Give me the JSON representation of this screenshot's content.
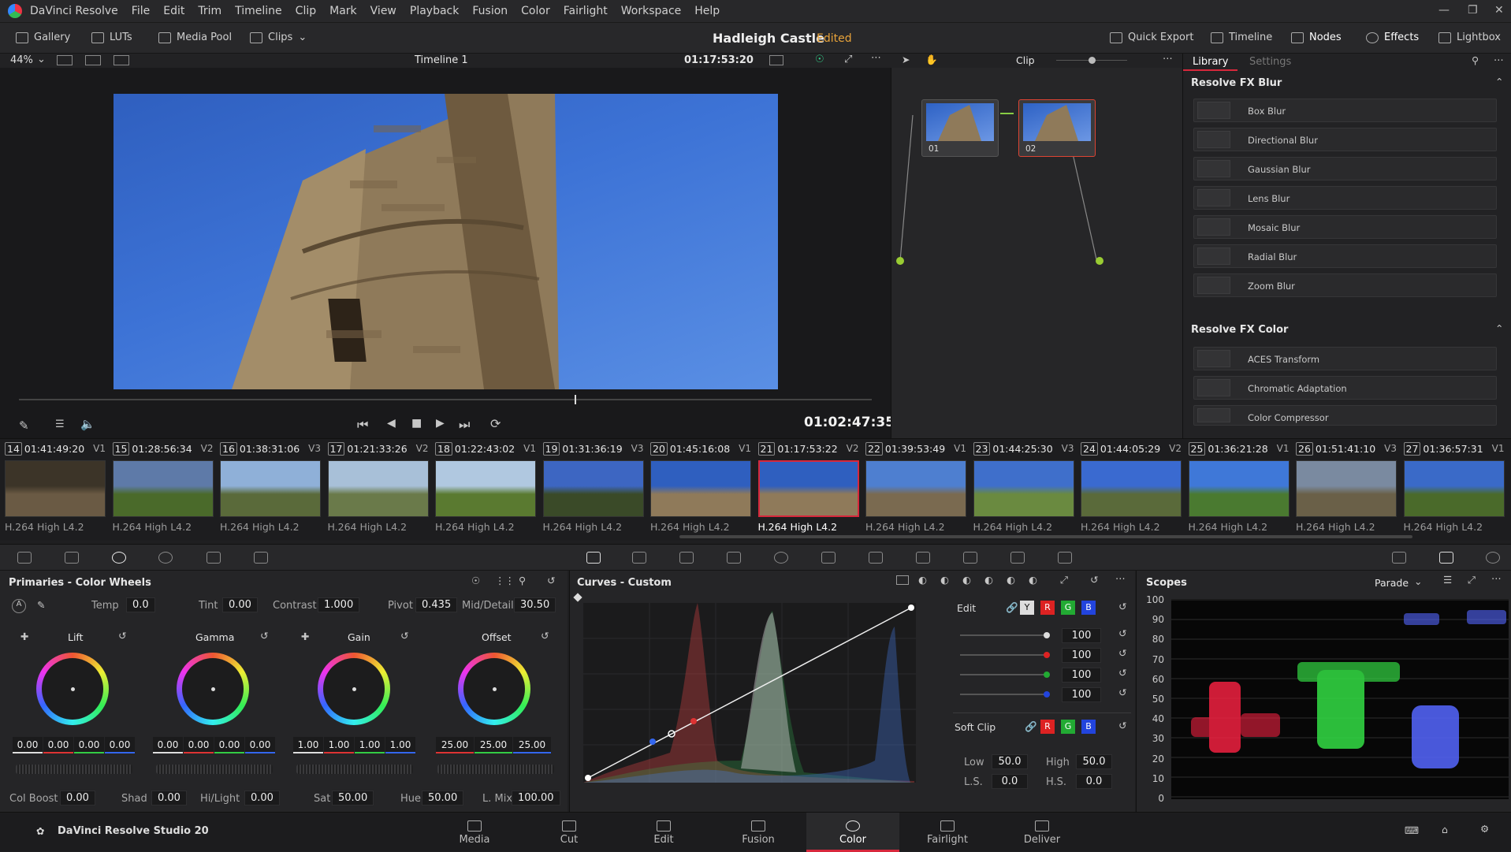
{
  "app": {
    "name": "DaVinci Resolve",
    "menus": [
      "File",
      "Edit",
      "Trim",
      "Timeline",
      "Clip",
      "Mark",
      "View",
      "Playback",
      "Fusion",
      "Color",
      "Fairlight",
      "Workspace",
      "Help"
    ]
  },
  "toolbar": {
    "gallery": "Gallery",
    "luts": "LUTs",
    "media_pool": "Media Pool",
    "clips": "Clips",
    "project_title": "Hadleigh Castle",
    "edited": "Edited",
    "quick_export": "Quick Export",
    "timeline": "Timeline",
    "nodes": "Nodes",
    "effects": "Effects",
    "lightbox": "Lightbox"
  },
  "viewer": {
    "zoom": "44%",
    "timeline_name": "Timeline 1",
    "source_tc": "01:17:53:20",
    "timecode": "01:02:47:35"
  },
  "node_editor": {
    "mode": "Clip",
    "nodes": [
      {
        "label": "01"
      },
      {
        "label": "02"
      }
    ]
  },
  "library": {
    "tabs": [
      "Library",
      "Settings"
    ],
    "sections": [
      {
        "title": "Resolve FX Blur",
        "items": [
          "Box Blur",
          "Directional Blur",
          "Gaussian Blur",
          "Lens Blur",
          "Mosaic Blur",
          "Radial Blur",
          "Zoom Blur"
        ]
      },
      {
        "title": "Resolve FX Color",
        "items": [
          "ACES Transform",
          "Chromatic Adaptation",
          "Color Compressor"
        ]
      }
    ]
  },
  "clips": [
    {
      "num": "14",
      "tc": "01:41:49:20",
      "track": "V1",
      "codec": "H.264 High L4.2"
    },
    {
      "num": "15",
      "tc": "01:28:56:34",
      "track": "V2",
      "codec": "H.264 High L4.2"
    },
    {
      "num": "16",
      "tc": "01:38:31:06",
      "track": "V3",
      "codec": "H.264 High L4.2"
    },
    {
      "num": "17",
      "tc": "01:21:33:26",
      "track": "V2",
      "codec": "H.264 High L4.2"
    },
    {
      "num": "18",
      "tc": "01:22:43:02",
      "track": "V1",
      "codec": "H.264 High L4.2"
    },
    {
      "num": "19",
      "tc": "01:31:36:19",
      "track": "V3",
      "codec": "H.264 High L4.2"
    },
    {
      "num": "20",
      "tc": "01:45:16:08",
      "track": "V1",
      "codec": "H.264 High L4.2"
    },
    {
      "num": "21",
      "tc": "01:17:53:22",
      "track": "V2",
      "codec": "H.264 High L4.2"
    },
    {
      "num": "22",
      "tc": "01:39:53:49",
      "track": "V1",
      "codec": "H.264 High L4.2"
    },
    {
      "num": "23",
      "tc": "01:44:25:30",
      "track": "V3",
      "codec": "H.264 High L4.2"
    },
    {
      "num": "24",
      "tc": "01:44:05:29",
      "track": "V2",
      "codec": "H.264 High L4.2"
    },
    {
      "num": "25",
      "tc": "01:36:21:28",
      "track": "V1",
      "codec": "H.264 High L4.2"
    },
    {
      "num": "26",
      "tc": "01:51:41:10",
      "track": "V3",
      "codec": "H.264 High L4.2"
    },
    {
      "num": "27",
      "tc": "01:36:57:31",
      "track": "V1",
      "codec": "H.264 High L4.2"
    }
  ],
  "primaries": {
    "title": "Primaries - Color Wheels",
    "temp_label": "Temp",
    "temp": "0.0",
    "tint_label": "Tint",
    "tint": "0.00",
    "contrast_label": "Contrast",
    "contrast": "1.000",
    "pivot_label": "Pivot",
    "pivot": "0.435",
    "middetail_label": "Mid/Detail",
    "middetail": "30.50",
    "wheels": [
      {
        "name": "Lift",
        "values": [
          "0.00",
          "0.00",
          "0.00",
          "0.00"
        ]
      },
      {
        "name": "Gamma",
        "values": [
          "0.00",
          "0.00",
          "0.00",
          "0.00"
        ]
      },
      {
        "name": "Gain",
        "values": [
          "1.00",
          "1.00",
          "1.00",
          "1.00"
        ]
      },
      {
        "name": "Offset",
        "values": [
          "25.00",
          "25.00",
          "25.00"
        ]
      }
    ],
    "colboost_label": "Col Boost",
    "colboost": "0.00",
    "shad_label": "Shad",
    "shad": "0.00",
    "hilight_label": "Hi/Light",
    "hilight": "0.00",
    "sat_label": "Sat",
    "sat": "50.00",
    "hue_label": "Hue",
    "hue": "50.00",
    "lmix_label": "L. Mix",
    "lmix": "100.00"
  },
  "curves": {
    "title": "Curves - Custom",
    "edit_label": "Edit",
    "channels": [
      "Y",
      "R",
      "G",
      "B"
    ],
    "intensities": [
      "100",
      "100",
      "100",
      "100"
    ],
    "soft_clip_label": "Soft Clip",
    "low_label": "Low",
    "low": "50.0",
    "high_label": "High",
    "high": "50.0",
    "ls_label": "L.S.",
    "ls": "0.0",
    "hs_label": "H.S.",
    "hs": "0.0"
  },
  "scopes": {
    "title": "Scopes",
    "mode": "Parade",
    "ticks": [
      "100",
      "90",
      "80",
      "70",
      "60",
      "50",
      "40",
      "30",
      "20",
      "10",
      "0"
    ]
  },
  "bottom": {
    "product": "DaVinci Resolve Studio 20",
    "pages": [
      "Media",
      "Cut",
      "Edit",
      "Fusion",
      "Color",
      "Fairlight",
      "Deliver"
    ],
    "active": "Color"
  }
}
